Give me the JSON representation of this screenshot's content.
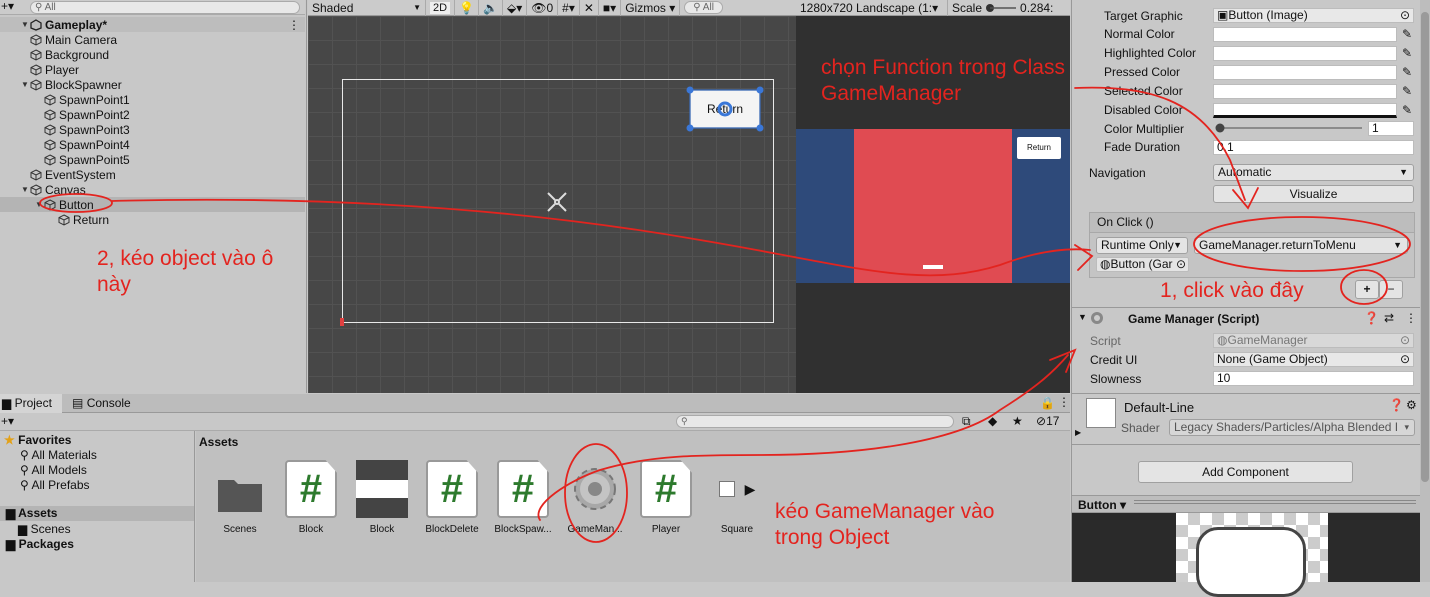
{
  "hierarchy": {
    "search_placeholder": "All",
    "scene_name": "Gameplay*",
    "items": [
      "Main Camera",
      "Background",
      "Player",
      "BlockSpawner",
      "SpawnPoint1",
      "SpawnPoint2",
      "SpawnPoint3",
      "SpawnPoint4",
      "SpawnPoint5",
      "EventSystem",
      "Canvas",
      "Button",
      "Return"
    ]
  },
  "scene_toolbar": {
    "shading": "Shaded",
    "mode2d": "2D",
    "fx_count": "0",
    "gizmos": "Gizmos",
    "search": "All"
  },
  "game_toolbar": {
    "resolution": "1280x720 Landscape (1:",
    "scale_label": "Scale",
    "scale_value": "0.284:"
  },
  "scene_view": {
    "button_text": "Return"
  },
  "game_view": {
    "button_text": "Return"
  },
  "inspector": {
    "target_graphic_label": "Target Graphic",
    "target_graphic_value": "Button (Image)",
    "normal_color": "Normal Color",
    "highlighted_color": "Highlighted Color",
    "pressed_color": "Pressed Color",
    "selected_color": "Selected Color",
    "disabled_color": "Disabled Color",
    "color_multiplier": "Color Multiplier",
    "color_multiplier_value": "1",
    "fade_duration": "Fade Duration",
    "fade_duration_value": "0.1",
    "navigation": "Navigation",
    "navigation_value": "Automatic",
    "visualize": "Visualize",
    "onclick_header": "On Click ()",
    "runtime": "Runtime Only",
    "function": "GameManager.returnToMenu",
    "object_field": "Button (Gar",
    "plus": "+",
    "minus": "−",
    "component_title": "Game Manager (Script)",
    "script_label": "Script",
    "script_value": "GameManager",
    "credit_label": "Credit UI",
    "credit_value": "None (Game Object)",
    "slowness_label": "Slowness",
    "slowness_value": "10",
    "material_name": "Default-Line",
    "shader_label": "Shader",
    "shader_value": "Legacy Shaders/Particles/Alpha Blended I",
    "add_component": "Add Component",
    "preview_label": "Button"
  },
  "project": {
    "tab_project": "Project",
    "tab_console": "Console",
    "favorites": "Favorites",
    "fav_items": [
      "All Materials",
      "All Models",
      "All Prefabs"
    ],
    "assets": "Assets",
    "scenes": "Scenes",
    "packages": "Packages",
    "breadcrumb": "Assets",
    "hidden_count": "17",
    "asset_names": [
      "Scenes",
      "Block",
      "Block",
      "BlockDelete",
      "BlockSpaw...",
      "GameMan...",
      "Player",
      "Square"
    ]
  },
  "annotations": {
    "top": [
      "chọn Function trong Class",
      "GameManager"
    ],
    "left": [
      "2, kéo object vào ô",
      "này"
    ],
    "right": "1, click vào đây",
    "bottom": [
      "kéo GameManager vào",
      "trong Object"
    ]
  },
  "colors": {
    "annotation": "#e3241f",
    "game_blue": "#2e4a7a",
    "game_red": "#e04b52",
    "script_hash": "#2d7a2d"
  }
}
